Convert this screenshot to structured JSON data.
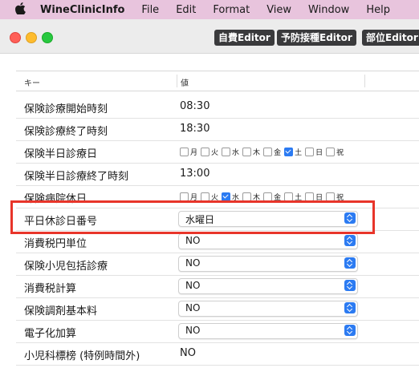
{
  "menubar": {
    "app_name": "WineClinicInfo",
    "items": [
      "File",
      "Edit",
      "Format",
      "View",
      "Window",
      "Help"
    ]
  },
  "toolbar": {
    "buttons": [
      "自費Editor",
      "予防接種Editor",
      "部位Editor"
    ]
  },
  "table": {
    "headers": {
      "key": "キー",
      "value": "値"
    },
    "day_labels": [
      "月",
      "火",
      "水",
      "木",
      "金",
      "土",
      "日",
      "祝"
    ],
    "rows": [
      {
        "key": "保険診療開始時刻",
        "value": "08:30"
      },
      {
        "key": "保険診療終了時刻",
        "value": "18:30"
      },
      {
        "key": "保険半日診療日",
        "checked": [
          false,
          false,
          false,
          false,
          false,
          true,
          false,
          false
        ]
      },
      {
        "key": "保険半日診療終了時刻",
        "value": "13:00"
      },
      {
        "key": "保険病院休日",
        "checked": [
          false,
          false,
          true,
          false,
          false,
          false,
          false,
          false
        ]
      },
      {
        "key": "平日休診日番号",
        "select": "水曜日"
      },
      {
        "key": "消費税円単位",
        "select": "NO"
      },
      {
        "key": "保険小児包括診療",
        "select": "NO"
      },
      {
        "key": "消費税計算",
        "select": "NO"
      },
      {
        "key": "保険調剤基本料",
        "select": "NO"
      },
      {
        "key": "電子化加算",
        "select": "NO"
      },
      {
        "key": "小児科標榜 (特例時間外)",
        "value": "NO"
      }
    ]
  },
  "colors": {
    "menubar": "#e8c4dd",
    "highlight": "#e8352a",
    "accent": "#2c7bf2"
  }
}
